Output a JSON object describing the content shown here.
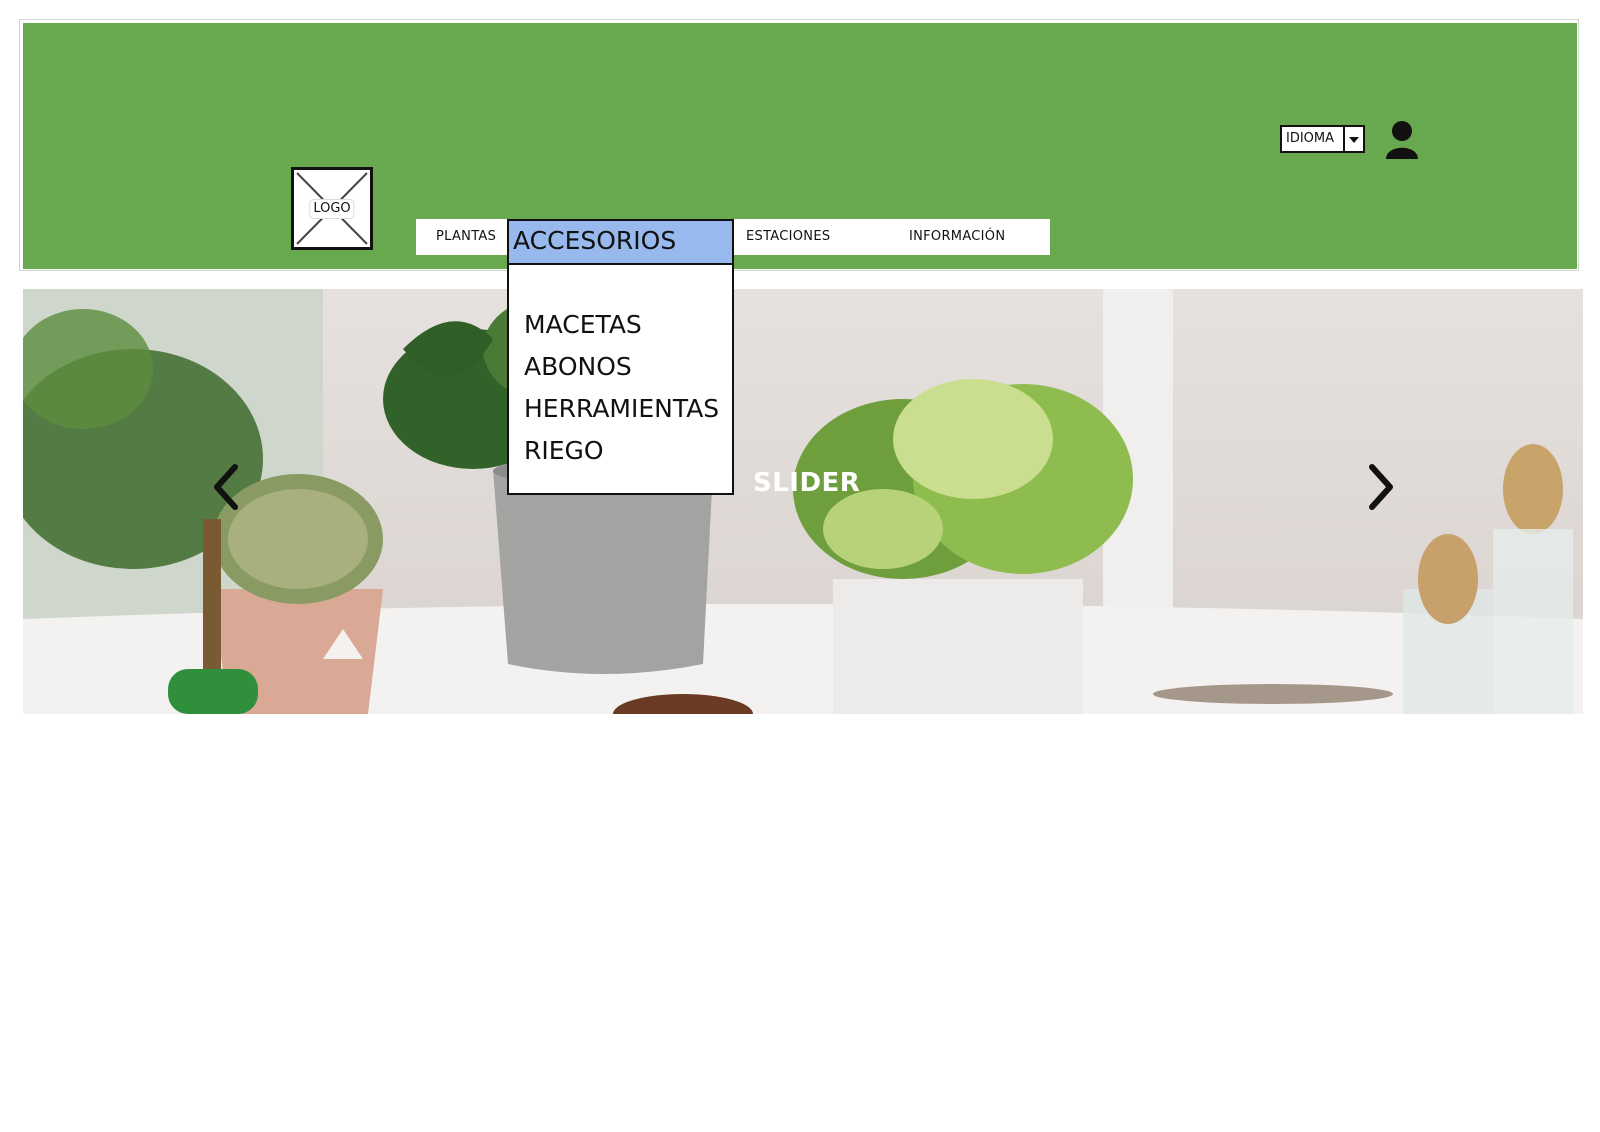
{
  "header": {
    "logo_label": "LOGO",
    "language_select": {
      "label": "IDIOMA"
    },
    "user_icon": "user-icon",
    "colors": {
      "header_bg": "#68a94f",
      "dropdown_highlight": "#97b9ee"
    }
  },
  "nav": {
    "items": [
      {
        "label": "PLANTAS"
      },
      {
        "label": "ACCESORIOS"
      },
      {
        "label": "ESTACIONES"
      },
      {
        "label": "INFORMACIÓN"
      }
    ]
  },
  "dropdown": {
    "title": "ACCESORIOS",
    "items": [
      {
        "label": "MACETAS"
      },
      {
        "label": "ABONOS"
      },
      {
        "label": "HERRAMIENTAS"
      },
      {
        "label": "RIEGO"
      }
    ]
  },
  "slider": {
    "label": "SLIDER",
    "prev_icon": "chevron-left-icon",
    "next_icon": "chevron-right-icon"
  }
}
